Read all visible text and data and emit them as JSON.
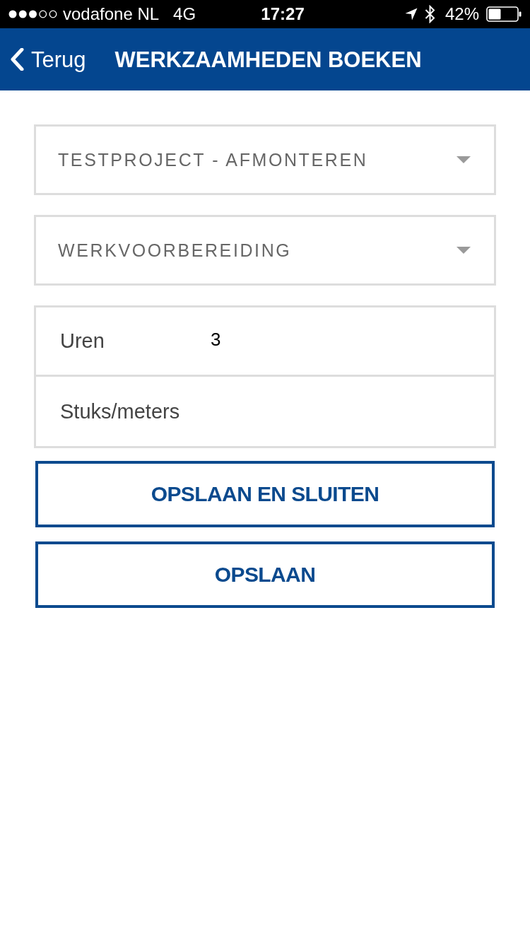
{
  "status_bar": {
    "carrier": "vodafone NL",
    "network": "4G",
    "time": "17:27",
    "battery": "42%"
  },
  "nav_bar": {
    "back_label": "Terug",
    "title": "WERKZAAMHEDEN BOEKEN"
  },
  "dropdowns": [
    {
      "value": "TESTPROJECT - AFMONTEREN"
    },
    {
      "value": "WERKVOORBEREIDING"
    }
  ],
  "fields": [
    {
      "label": "Uren",
      "value": "3"
    },
    {
      "label": "Stuks/meters"
    }
  ],
  "buttons": [
    {
      "label": "OPSLAAN EN SLUITEN"
    },
    {
      "label": "OPSLAAN"
    }
  ]
}
